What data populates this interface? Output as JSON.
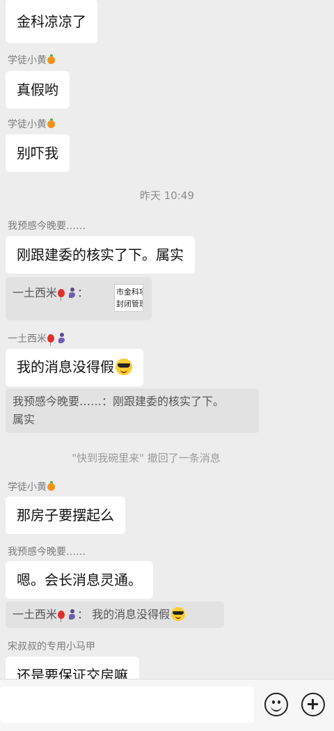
{
  "chat": {
    "top_bubble": "金科凉凉了",
    "sender_xiaohuang": "学徒小黄",
    "msg_zhenjia": "真假哟",
    "msg_biexia": "别吓我",
    "timestamp": "昨天 10:49",
    "sender_yuganjin": "我预感今晚要……",
    "msg_gang": "刚跟建委的核实了下。属实",
    "quote1_sender": "一土西米",
    "quote1_colon": "：",
    "quote1_thumb_line1": "市金科项",
    "quote1_thumb_line2": "封闭管理",
    "sender_yitu": "一土西米",
    "msg_xiaoxi": "我的消息没得假",
    "quote2_line1": "我预感今晚要……：刚跟建委的核实了下。",
    "quote2_line2": "属实",
    "recall_notice": "\"快到我碗里来\" 撤回了一条消息",
    "msg_fangzi": "那房子要摆起么",
    "msg_en": "嗯。会长消息灵通。",
    "quote3_sender": "一土西米",
    "quote3_text": "：  我的消息没得假",
    "sender_songshushu": "宋叔叔的专用小马甲",
    "msg_baozheng": "还是要保证交房嘛"
  },
  "icons": {
    "orange": "tangerine-emoji",
    "balloon": "red-balloon-emoji",
    "genie": "genie-emoji",
    "cool": "sunglasses-face-emoji",
    "emoji_button": "smiley-face-icon",
    "more_button": "plus-circle-icon"
  },
  "colors": {
    "background": "#ededed",
    "bubble": "#ffffff",
    "quote": "#e2e2e2",
    "meta_text": "#7b7b7b"
  }
}
